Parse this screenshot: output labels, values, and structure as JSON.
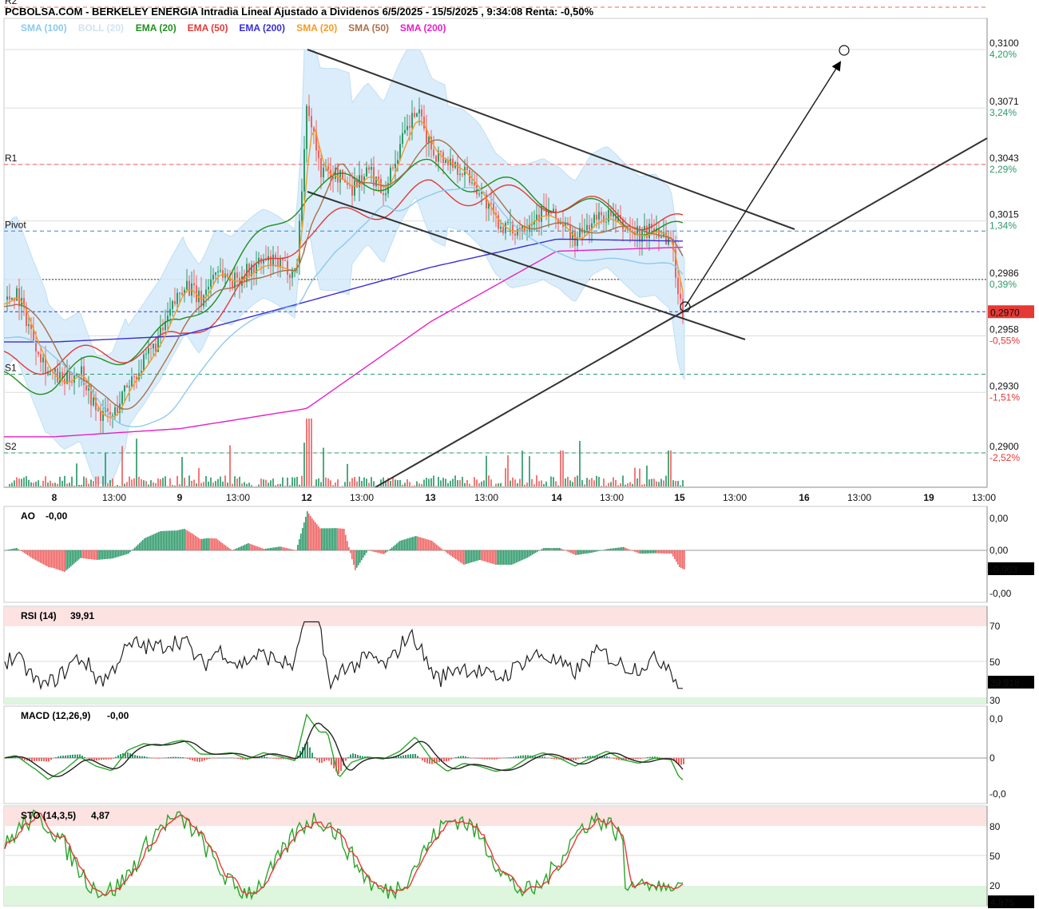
{
  "title": "PCBOLSA.COM - BERKELEY ENERGIA Intradia Lineal Ajustado a Dividenos 6/5/2025 - 15/5/2025 , 9:34:08 Renta: -0,50%",
  "legend": [
    {
      "text": "SMA (100)",
      "color": "#8ec9ee"
    },
    {
      "text": "BOLL (20)",
      "color": "#cfe3f3"
    },
    {
      "text": "EMA (20)",
      "color": "#1f8f1f"
    },
    {
      "text": "EMA (50)",
      "color": "#e53935"
    },
    {
      "text": "EMA (200)",
      "color": "#3a2bd9"
    },
    {
      "text": "SMA (20)",
      "color": "#f59a23"
    },
    {
      "text": "SMA (50)",
      "color": "#a9704a"
    },
    {
      "text": "SMA (200)",
      "color": "#e61ec8"
    }
  ],
  "colors": {
    "up": "#2e9a6a",
    "down": "#f06262",
    "grid": "#dddddd"
  },
  "price_axis": [
    {
      "price": "0,3100",
      "pct": "4,20%",
      "dir": "up",
      "v": 0.31
    },
    {
      "price": "0,3071",
      "pct": "3,24%",
      "dir": "up",
      "v": 0.3071
    },
    {
      "price": "0,3043",
      "pct": "2,29%",
      "dir": "up",
      "v": 0.3043
    },
    {
      "price": "0,3015",
      "pct": "1,34%",
      "dir": "up",
      "v": 0.3015
    },
    {
      "price": "0,2986",
      "pct": "0,39%",
      "dir": "up",
      "v": 0.2986
    },
    {
      "price": "0,2958",
      "pct": "-0,55%",
      "dir": "down",
      "v": 0.2958
    },
    {
      "price": "0,2930",
      "pct": "-1,51%",
      "dir": "down",
      "v": 0.293
    },
    {
      "price": "0,2900",
      "pct": "-2,52%",
      "dir": "down",
      "v": 0.29
    }
  ],
  "last_price": {
    "text": "0,2970",
    "v": 0.297
  },
  "pivots": [
    {
      "label": "R2",
      "v": 0.3121,
      "color": "#f06262"
    },
    {
      "label": "R1",
      "v": 0.3043,
      "color": "#f06262"
    },
    {
      "label": "Pivot",
      "v": 0.301,
      "color": "#3b82d6"
    },
    {
      "label": "S1",
      "v": 0.2939,
      "color": "#2e9a6a"
    },
    {
      "label": "S2",
      "v": 0.29,
      "color": "#2e9a6a"
    }
  ],
  "prev_close": 0.2986,
  "time_axis": [
    "8",
    "13:00",
    "9",
    "13:00",
    "12",
    "13:00",
    "13",
    "13:00",
    "14",
    "13:00",
    "15",
    "13:00",
    "16",
    "13:00",
    "19",
    "13:00"
  ],
  "time_axis_bold": [
    true,
    false,
    true,
    false,
    true,
    false,
    true,
    false,
    true,
    false,
    true,
    false,
    true,
    false,
    true,
    false
  ],
  "ao": {
    "label": "AO",
    "value": "-0,00",
    "axis": [
      "0,00",
      "0,00",
      "-0,00"
    ],
    "last": "-0,003"
  },
  "rsi": {
    "label": "RSI (14)",
    "value": "39,91",
    "axis": [
      "70",
      "50",
      "30"
    ],
    "last": "39,918"
  },
  "macd": {
    "label": "MACD (12,26,9)",
    "value": "-0,00",
    "axis": [
      "0,0",
      "0",
      "-0,0"
    ]
  },
  "sto": {
    "label": "STO (14,3,5)",
    "value": "4,87",
    "axis": [
      "80",
      "50",
      "20"
    ],
    "last": "4,875"
  },
  "chart_data": {
    "type": "line",
    "title": "PCBOLSA.COM - BERKELEY ENERGIA Intradia Lineal Ajustado a Dividenos 6/5/2025 - 15/5/2025 , 9:34:08 Renta: -0,50%",
    "x_sessions": [
      "8",
      "9",
      "12",
      "13",
      "14",
      "15"
    ],
    "y_range": [
      0.2885,
      0.313
    ],
    "series": [
      {
        "name": "EMA (20)",
        "values_by_session": [
          0.2935,
          0.2962,
          0.303,
          0.304,
          0.3025,
          0.3008
        ]
      },
      {
        "name": "EMA (50)",
        "values_by_session": [
          0.2945,
          0.2955,
          0.301,
          0.303,
          0.3025,
          0.3012
        ]
      },
      {
        "name": "EMA (200)",
        "values_by_session": [
          0.2955,
          0.2958,
          0.2975,
          0.2992,
          0.3006,
          0.3005
        ]
      },
      {
        "name": "SMA (200)",
        "values_by_session": [
          0.2908,
          0.2912,
          0.2922,
          0.2965,
          0.3,
          0.3002
        ]
      }
    ],
    "rsi_last": 39.918,
    "sto_last": 4.875,
    "ao_last": -0.003,
    "last_price": 0.297
  }
}
